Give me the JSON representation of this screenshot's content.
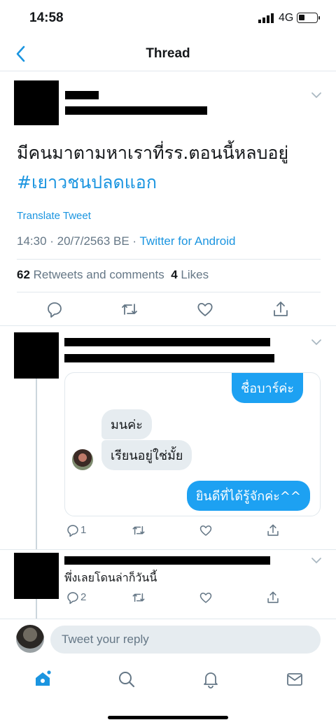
{
  "status_bar": {
    "time": "14:58",
    "network": "4G"
  },
  "header": {
    "title": "Thread",
    "back_icon": "chevron-left-icon"
  },
  "main_tweet": {
    "text_plain": "มีคนมาตามหาเราที่รร.ตอนนี้หลบอยู่ ",
    "hashtag": "#เยาวชนปลดแอก",
    "translate_label": "Translate Tweet",
    "timestamp": "14:30 · 20/7/2563 BE · ",
    "source": "Twitter for Android",
    "retweets_count": "62",
    "retweets_label": "Retweets and comments",
    "likes_count": "4",
    "likes_label": "Likes"
  },
  "reply_1": {
    "dm_messages": [
      {
        "text": "ชื่อบาร์ค่ะ",
        "direction": "out"
      },
      {
        "text": "มนค่ะ",
        "direction": "in"
      },
      {
        "text": "เรียนอยู่ใช่มั้ย",
        "direction": "in"
      },
      {
        "text": "ยินดีที่ได้รู้จักค่ะ^^",
        "direction": "out"
      }
    ],
    "reply_count": "1"
  },
  "reply_2": {
    "text": "พึ่งเลยโดนล่าก็วันนี้",
    "reply_count": "2"
  },
  "composer": {
    "placeholder": "Tweet your reply"
  },
  "colors": {
    "accent": "#1b95e0",
    "bubble_out": "#1da1f2",
    "bubble_in": "#e6ecf0",
    "muted": "#657786"
  },
  "tab_icons": [
    "home-icon",
    "search-icon",
    "bell-icon",
    "mail-icon"
  ]
}
